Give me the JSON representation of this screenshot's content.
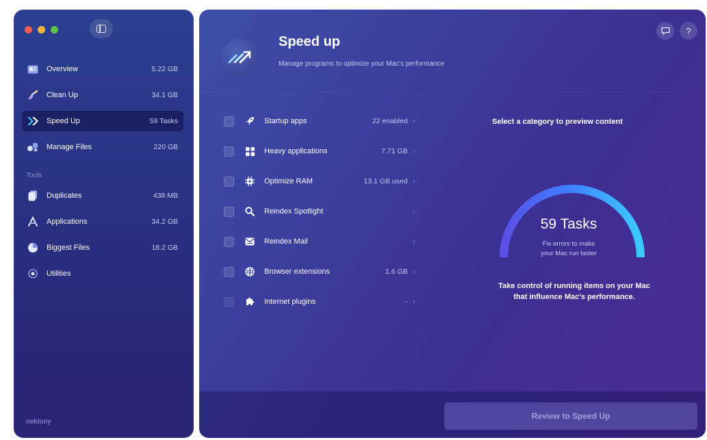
{
  "sidebar": {
    "items": [
      {
        "label": "Overview",
        "value": "5.22 GB",
        "icon": "overview-icon"
      },
      {
        "label": "Clean Up",
        "value": "34.1 GB",
        "icon": "broom-icon"
      },
      {
        "label": "Speed Up",
        "value": "59 Tasks",
        "icon": "speed-icon"
      },
      {
        "label": "Manage Files",
        "value": "220 GB",
        "icon": "files-icon"
      }
    ],
    "tools_label": "Tools",
    "tools": [
      {
        "label": "Duplicates",
        "value": "438 MB",
        "icon": "duplicates-icon"
      },
      {
        "label": "Applications",
        "value": "34.2 GB",
        "icon": "applications-icon"
      },
      {
        "label": "Biggest Files",
        "value": "18.2 GB",
        "icon": "pie-icon"
      },
      {
        "label": "Utilities",
        "value": "",
        "icon": "utilities-icon"
      }
    ],
    "brand": "nektony"
  },
  "header": {
    "title": "Speed up",
    "subtitle": "Manage programs to optimize your Mac's performance"
  },
  "tasks": [
    {
      "label": "Startup apps",
      "value": "22 enabled",
      "icon": "rocket-icon"
    },
    {
      "label": "Heavy applications",
      "value": "7.71 GB",
      "icon": "grid-icon"
    },
    {
      "label": "Optimize RAM",
      "value": "13.1 GB used",
      "icon": "chip-icon"
    },
    {
      "label": "Reindex Spotlight",
      "value": "",
      "icon": "search-icon"
    },
    {
      "label": "Reindex Mail",
      "value": "",
      "icon": "mail-icon"
    },
    {
      "label": "Browser extensions",
      "value": "1.6 GB",
      "icon": "globe-icon"
    },
    {
      "label": "Internet plugins",
      "value": "-",
      "icon": "puzzle-icon"
    }
  ],
  "preview": {
    "message": "Select a category to preview content",
    "gauge_title": "59 Tasks",
    "gauge_sub_1": "Fix errors to make",
    "gauge_sub_2": "your Mac run faster",
    "desc_1": "Take control of running items on your Mac",
    "desc_2": "that influence Mac's performance."
  },
  "footer": {
    "review_label": "Review to Speed Up"
  },
  "colors": {
    "accent": "#3a7bff",
    "gauge_end": "#38c8ff",
    "active_bg": "#1b1f63"
  }
}
